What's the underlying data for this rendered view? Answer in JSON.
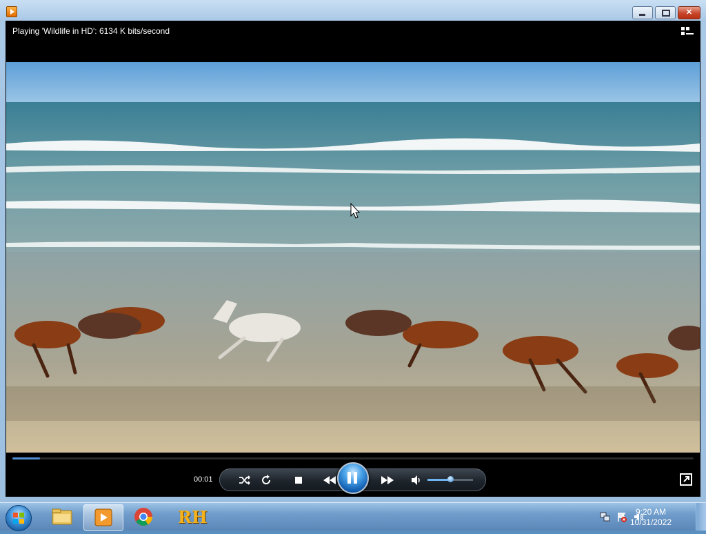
{
  "window": {
    "close_glyph": "✕"
  },
  "player": {
    "status_text": "Playing 'Wildlife in HD': 6134 K bits/second",
    "elapsed_time": "00:01",
    "seek_progress": 0.04,
    "volume_level": 0.5
  },
  "taskbar": {
    "pinned": [
      "windows-explorer",
      "windows-media-player",
      "google-chrome",
      "rh-app"
    ],
    "rh_label": "RH",
    "clock_time": "9:20 AM",
    "clock_date": "10/31/2022"
  },
  "colors": {
    "accent": "#4f8fd6",
    "titlebar": "#b7d1ec",
    "close": "#c7452b"
  }
}
